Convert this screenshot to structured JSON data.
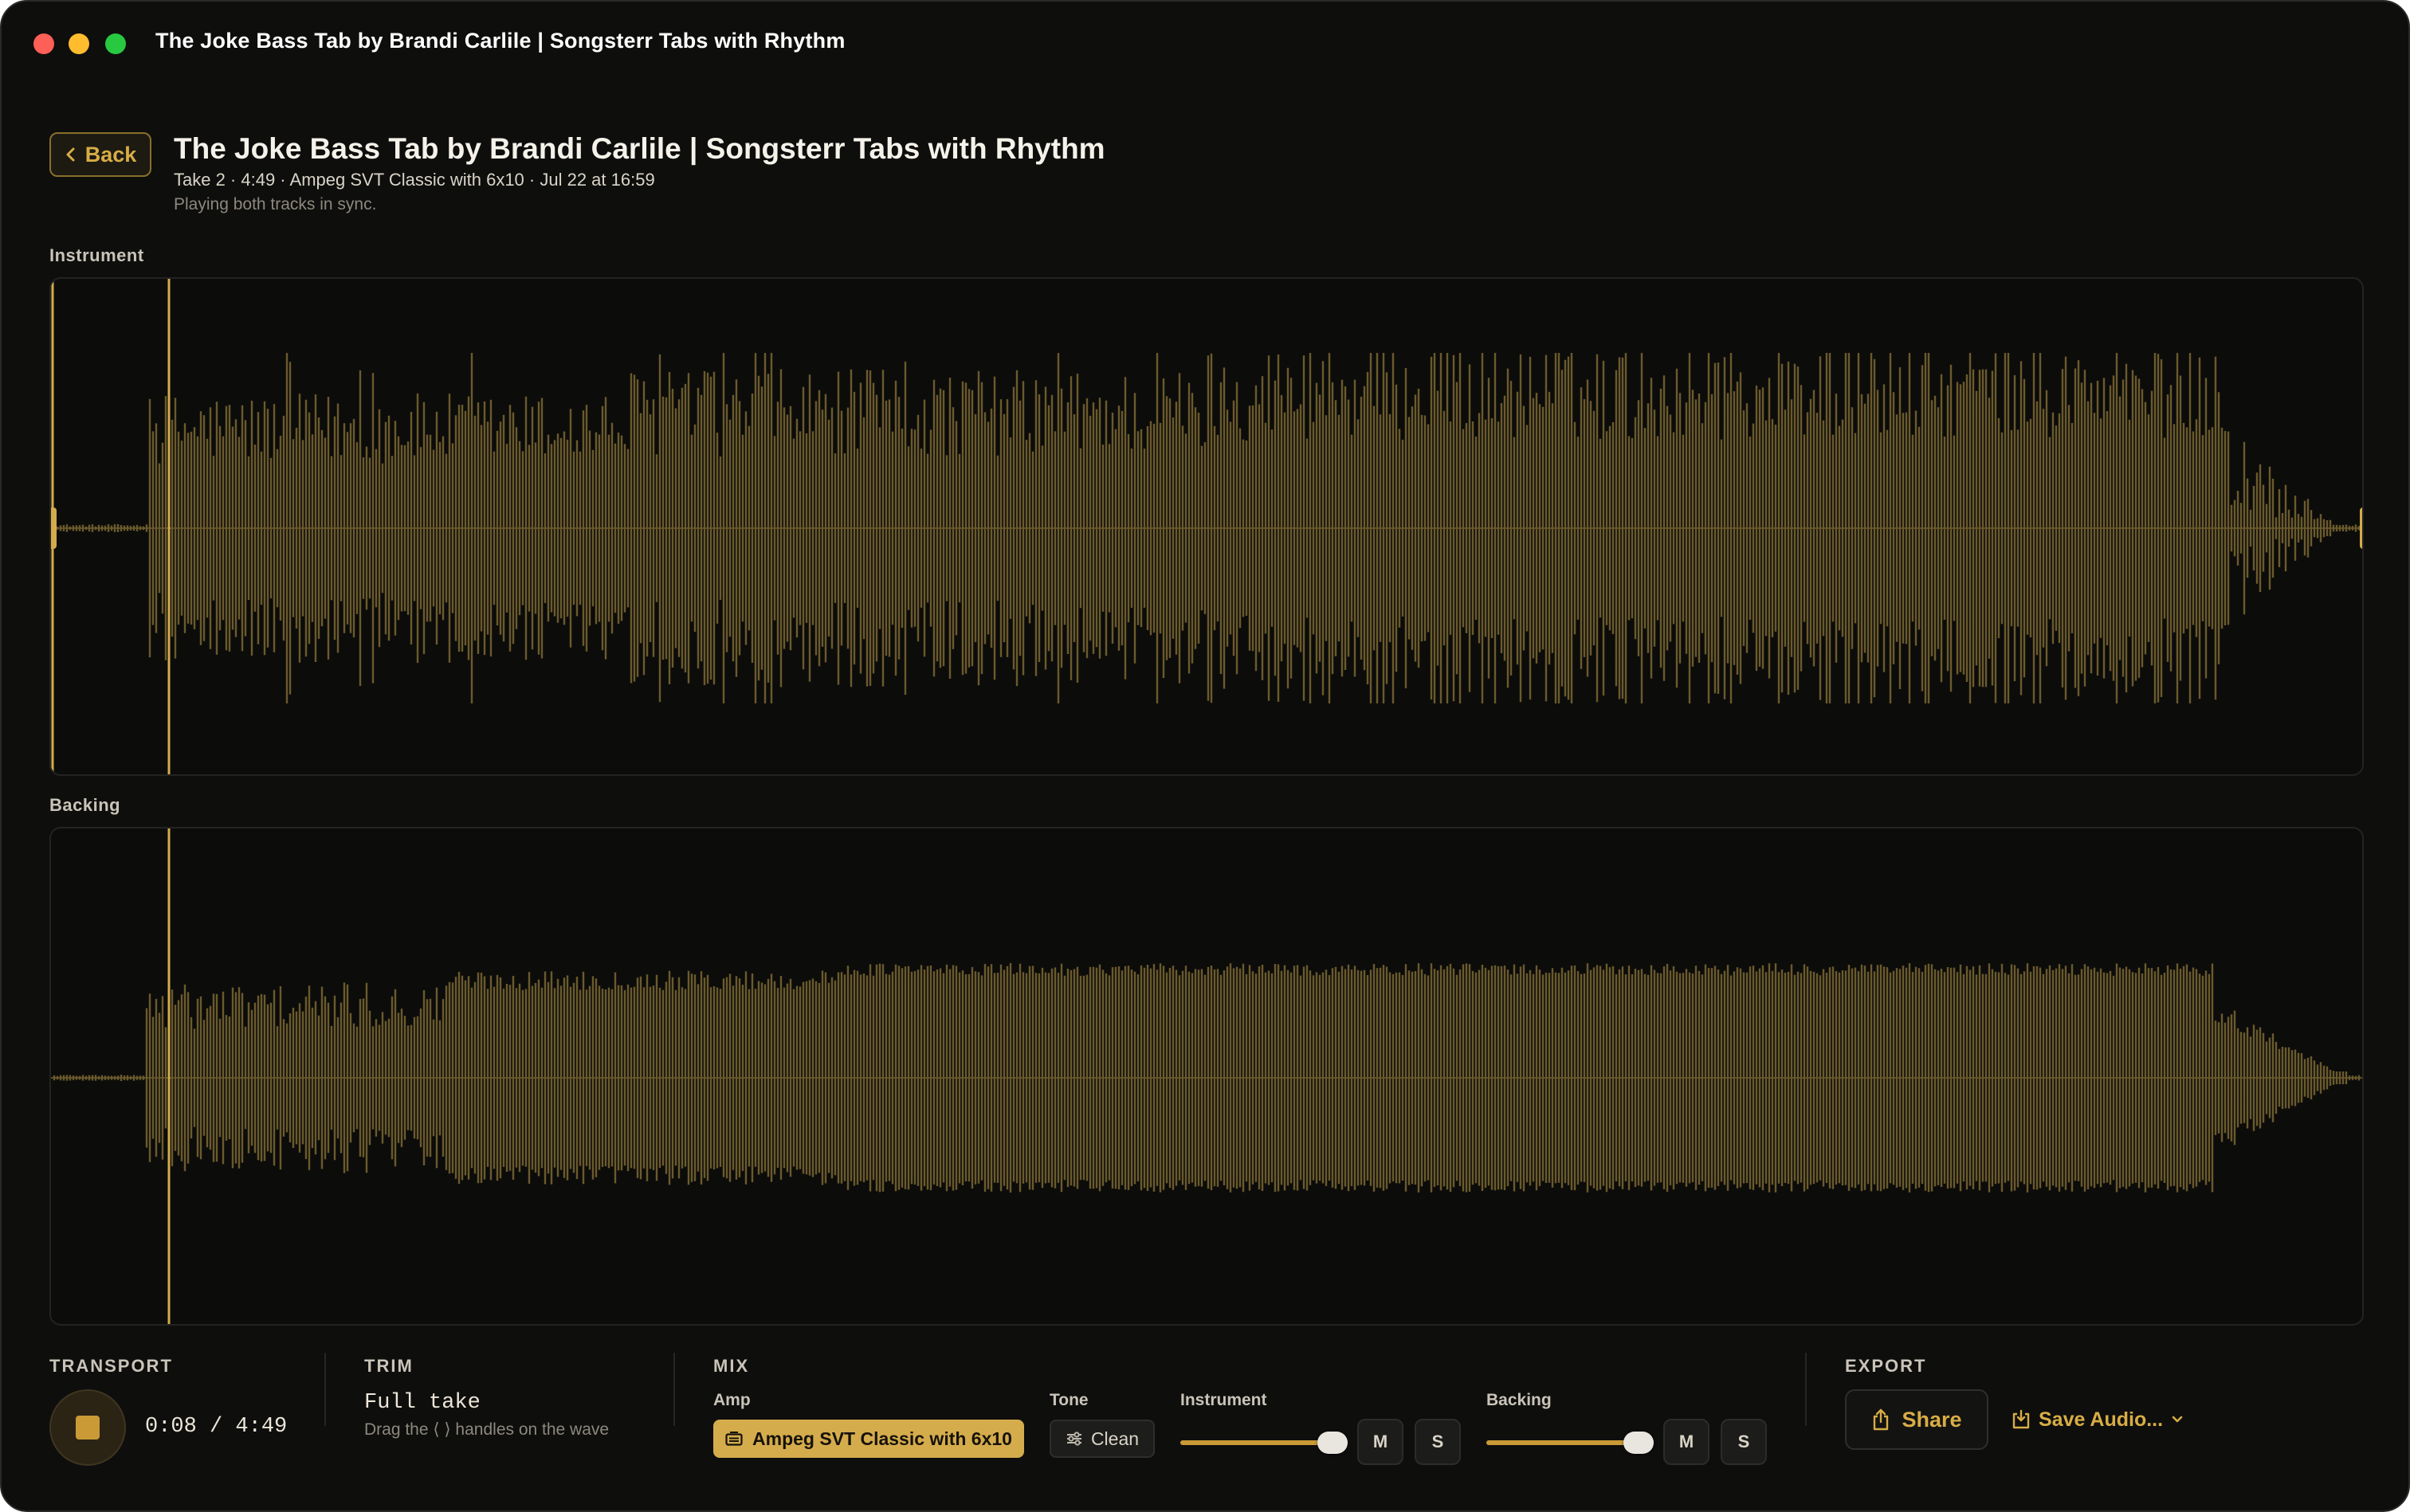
{
  "window": {
    "title": "The Joke Bass Tab by Brandi Carlile | Songsterr Tabs with Rhythm"
  },
  "header": {
    "back_label": "Back",
    "title": "The Joke Bass Tab by Brandi Carlile | Songsterr Tabs with Rhythm",
    "meta": "Take 2 · 4:49 · Ampeg SVT Classic with 6x10 · Jul 22 at 16:59",
    "status": "Playing both tracks in sync."
  },
  "tracks": {
    "instrument_label": "Instrument",
    "backing_label": "Backing",
    "playhead_fraction": 0.0277
  },
  "transport": {
    "heading": "TRANSPORT",
    "time": "0:08 / 4:49"
  },
  "trim": {
    "heading": "TRIM",
    "value": "Full take",
    "hint": "Drag the ⟨ ⟩ handles on the wave"
  },
  "mix": {
    "heading": "MIX",
    "amp_label": "Amp",
    "amp_value": "Ampeg SVT Classic with 6x10",
    "tone_label": "Tone",
    "tone_value": "Clean",
    "instrument_label": "Instrument",
    "instrument_level": 1.0,
    "backing_label": "Backing",
    "backing_level": 1.0,
    "mute_label": "M",
    "solo_label": "S"
  },
  "export": {
    "heading": "EXPORT",
    "share_label": "Share",
    "save_label": "Save Audio..."
  },
  "colors": {
    "accent": "#d5ac4c",
    "wave": "#6b5a2c",
    "background": "#0e0e0d"
  }
}
